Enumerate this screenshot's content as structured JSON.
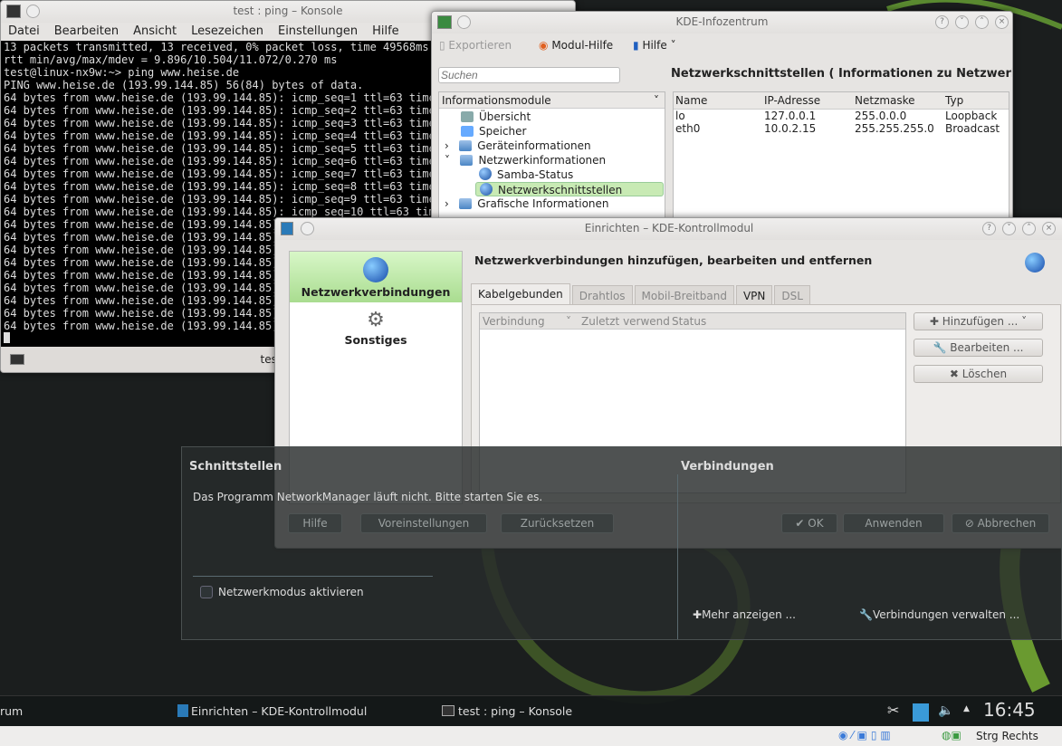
{
  "konsole": {
    "title": "test : ping – Konsole",
    "menu": [
      "Datei",
      "Bearbeiten",
      "Ansicht",
      "Lesezeichen",
      "Einstellungen",
      "Hilfe"
    ],
    "lines": [
      "13 packets transmitted, 13 received, 0% packet loss, time 49568ms",
      "rtt min/avg/max/mdev = 9.896/10.504/11.072/0.270 ms",
      "test@linux-nx9w:~> ping www.heise.de",
      "PING www.heise.de (193.99.144.85) 56(84) bytes of data.",
      "64 bytes from www.heise.de (193.99.144.85): icmp_seq=1 ttl=63 time=",
      "64 bytes from www.heise.de (193.99.144.85): icmp_seq=2 ttl=63 time=",
      "64 bytes from www.heise.de (193.99.144.85): icmp_seq=3 ttl=63 time=",
      "64 bytes from www.heise.de (193.99.144.85): icmp_seq=4 ttl=63 time=",
      "64 bytes from www.heise.de (193.99.144.85): icmp_seq=5 ttl=63 time=",
      "64 bytes from www.heise.de (193.99.144.85): icmp_seq=6 ttl=63 time=",
      "64 bytes from www.heise.de (193.99.144.85): icmp_seq=7 ttl=63 time=",
      "64 bytes from www.heise.de (193.99.144.85): icmp_seq=8 ttl=63 time=",
      "64 bytes from www.heise.de (193.99.144.85): icmp_seq=9 ttl=63 time=",
      "64 bytes from www.heise.de (193.99.144.85): icmp_seq=10 ttl=63 time=",
      "64 bytes from www.heise.de (193.99.144.85):",
      "64 bytes from www.heise.de (193.99.144.85):",
      "64 bytes from www.heise.de (193.99.144.85):",
      "64 bytes from www.heise.de (193.99.144.85):",
      "64 bytes from www.heise.de (193.99.144.85):",
      "64 bytes from www.heise.de (193.99.144.85):",
      "64 bytes from www.heise.de (193.99.144.85):",
      "64 bytes from www.heise.de (193.99.144.85):",
      "64 bytes from www.heise.de (193.99.144.85):"
    ],
    "tab": "test : ping"
  },
  "info": {
    "title": "KDE-Infozentrum",
    "toolbar": {
      "export": "Exportieren",
      "module_help": "Modul-Hilfe",
      "help": "Hilfe"
    },
    "search_placeholder": "Suchen",
    "heading": "Netzwerkschnittstellen  ( Informationen zu Netzwerksc",
    "tree_header": "Informationsmodule",
    "tree": [
      "Übersicht",
      "Speicher",
      "Geräteinformationen",
      "Netzwerkinformationen",
      "Samba-Status",
      "Netzwerkschnittstellen",
      "Grafische Informationen"
    ],
    "columns": [
      "Name",
      "IP-Adresse",
      "Netzmaske",
      "Typ"
    ],
    "rows": [
      [
        "lo",
        "127.0.0.1",
        "255.0.0.0",
        "Loopback"
      ],
      [
        "eth0",
        "10.0.2.15",
        "255.255.255.0",
        "Broadcast"
      ]
    ]
  },
  "kcm": {
    "title": "Einrichten – KDE-Kontrollmodul",
    "sidebar": [
      "Netzwerkverbindungen",
      "Sonstiges"
    ],
    "heading": "Netzwerkverbindungen hinzufügen, bearbeiten und entfernen",
    "tabs": [
      "Kabelgebunden",
      "Drahtlos",
      "Mobil-Breitband",
      "VPN",
      "DSL"
    ],
    "columns": [
      "Verbindung",
      "Zuletzt verwend",
      "Status"
    ],
    "buttons": {
      "add": "Hinzufügen ...",
      "edit": "Bearbeiten ...",
      "delete": "Löschen"
    },
    "footer": {
      "help": "Hilfe",
      "defaults": "Voreinstellungen",
      "reset": "Zurücksetzen",
      "ok": "OK",
      "apply": "Anwenden",
      "cancel": "Abbrechen"
    }
  },
  "popup": {
    "interfaces_title": "Schnittstellen",
    "connections_title": "Verbindungen",
    "message": "Das Programm NetworkManager läuft nicht. Bitte starten Sie es.",
    "network_mode": "Netzwerkmodus aktivieren",
    "more": "Mehr anzeigen ...",
    "manage": "Verbindungen verwalten ..."
  },
  "taskbar": {
    "tasks": [
      "rum",
      "Einrichten – KDE-Kontrollmodul",
      "test : ping – Konsole"
    ],
    "clock": "16:45"
  },
  "vbox": {
    "hostkey": "Strg Rechts"
  },
  "colors": {
    "selection": "#c8eab4",
    "desktop": "#1b1e1e",
    "accent_green": "#8ab848"
  }
}
